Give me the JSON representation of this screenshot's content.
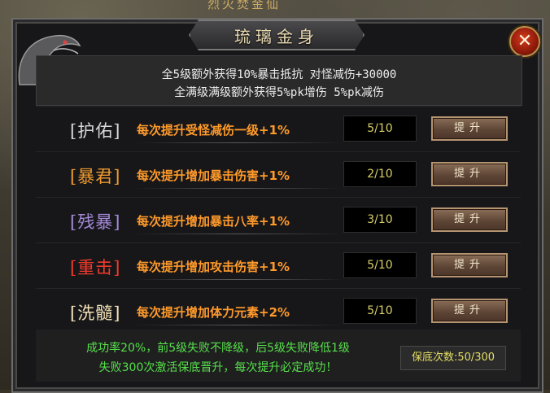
{
  "scene": {
    "top_title": "烈火焚金仙"
  },
  "dialog": {
    "title": "琉璃金身",
    "close_symbol": "✕",
    "info": {
      "line1": "全5级额外获得10%暴击抵抗 对怪减伤+30000",
      "line2": "全满级满级额外获得5%pk增伤 5%pk减伤"
    },
    "rows": [
      {
        "name": "[护佑]",
        "desc": "每次提升受怪减伤一级+1%",
        "level": "5/10",
        "button": "提升",
        "color": "#d8d8d8"
      },
      {
        "name": "[暴君]",
        "desc": "每次提升增加暴击伤害+1%",
        "level": "2/10",
        "button": "提升",
        "color": "#ee9a2e"
      },
      {
        "name": "[残暴]",
        "desc": "每次提升增加暴击八率+1%",
        "level": "3/10",
        "button": "提升",
        "color": "#a58ad9"
      },
      {
        "name": "[重击]",
        "desc": "每次提升增加攻击伤害+1%",
        "level": "5/10",
        "button": "提升",
        "color": "#f13a2a"
      },
      {
        "name": "[洗髓]",
        "desc": "每次提升增加体力元素+2%",
        "level": "5/10",
        "button": "提升",
        "color": "#f2e0b6"
      }
    ],
    "desc_colors": [
      "#ff9a2a",
      "#ff9a2a",
      "#ff9a2a",
      "#ff9a2a",
      "#ff9a2a"
    ],
    "bottom": {
      "line1": "成功率20%，前5级失败不降级，后5级失败降低1级",
      "line2": "失败300次激活保底晋升，每次提升必定成功！",
      "guarantee": "保底次数:50/300"
    },
    "icons": {
      "close": "close-icon",
      "decoration": "dragon-icon"
    }
  }
}
